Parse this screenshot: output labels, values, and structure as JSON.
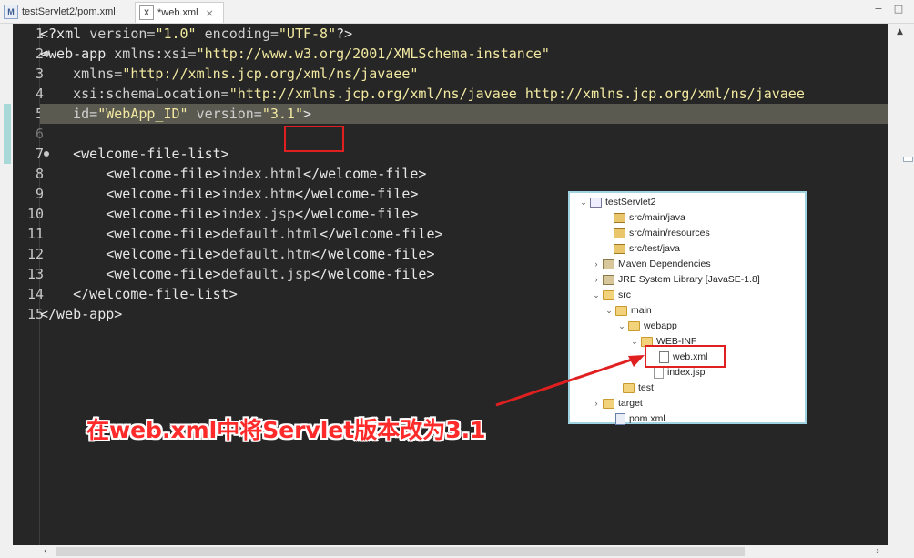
{
  "tabs": [
    {
      "label": "testServlet2/pom.xml",
      "icon": "pom-file-icon",
      "active": false
    },
    {
      "label": "*web.xml",
      "icon": "xml-file-icon",
      "active": true
    }
  ],
  "window_controls": {
    "minimize": "−",
    "maximize": "□"
  },
  "editor": {
    "line_numbers": [
      "1",
      "2",
      "3",
      "4",
      "5",
      "6",
      "7",
      "8",
      "9",
      "10",
      "11",
      "12",
      "13",
      "14",
      "15"
    ],
    "lines": [
      [
        {
          "t": "tag",
          "s": "<?xml "
        },
        {
          "t": "attr",
          "s": "version="
        },
        {
          "t": "str",
          "s": "\"1.0\""
        },
        {
          "t": "attr",
          "s": " encoding="
        },
        {
          "t": "str",
          "s": "\"UTF-8\""
        },
        {
          "t": "tag",
          "s": "?>"
        }
      ],
      [
        {
          "t": "tag",
          "s": "<web-app "
        },
        {
          "t": "attr",
          "s": "xmlns:xsi="
        },
        {
          "t": "str",
          "s": "\"http://www.w3.org/2001/XMLSchema-instance\""
        }
      ],
      [
        {
          "t": "attr",
          "s": "    xmlns="
        },
        {
          "t": "str",
          "s": "\"http://xmlns.jcp.org/xml/ns/javaee\""
        }
      ],
      [
        {
          "t": "attr",
          "s": "    xsi:schemaLocation="
        },
        {
          "t": "str",
          "s": "\"http://xmlns.jcp.org/xml/ns/javaee http://xmlns.jcp.org/xml/ns/javaee"
        }
      ],
      [
        {
          "t": "attr",
          "s": "    id="
        },
        {
          "t": "str",
          "s": "\"WebApp_ID\""
        },
        {
          "t": "attr",
          "s": " version="
        },
        {
          "t": "str",
          "s": "\"3.1\""
        },
        {
          "t": "tag",
          "s": ">"
        }
      ],
      [],
      [
        {
          "t": "tag",
          "s": "    <welcome-file-list>"
        }
      ],
      [
        {
          "t": "tag",
          "s": "        <welcome-file>"
        },
        {
          "t": "attr",
          "s": "index.html"
        },
        {
          "t": "tag",
          "s": "</welcome-file>"
        }
      ],
      [
        {
          "t": "tag",
          "s": "        <welcome-file>"
        },
        {
          "t": "attr",
          "s": "index.htm"
        },
        {
          "t": "tag",
          "s": "</welcome-file>"
        }
      ],
      [
        {
          "t": "tag",
          "s": "        <welcome-file>"
        },
        {
          "t": "attr",
          "s": "index.jsp"
        },
        {
          "t": "tag",
          "s": "</welcome-file>"
        }
      ],
      [
        {
          "t": "tag",
          "s": "        <welcome-file>"
        },
        {
          "t": "attr",
          "s": "default.html"
        },
        {
          "t": "tag",
          "s": "</welcome-file>"
        }
      ],
      [
        {
          "t": "tag",
          "s": "        <welcome-file>"
        },
        {
          "t": "attr",
          "s": "default.htm"
        },
        {
          "t": "tag",
          "s": "</welcome-file>"
        }
      ],
      [
        {
          "t": "tag",
          "s": "        <welcome-file>"
        },
        {
          "t": "attr",
          "s": "default.jsp"
        },
        {
          "t": "tag",
          "s": "</welcome-file>"
        }
      ],
      [
        {
          "t": "tag",
          "s": "    </welcome-file-list>"
        }
      ],
      [
        {
          "t": "tag",
          "s": "</web-app>"
        }
      ]
    ],
    "current_line": "5"
  },
  "project_tree": {
    "items": [
      {
        "label": "testServlet2",
        "icon": "project-icon",
        "chevron": "open"
      },
      {
        "label": "src/main/java",
        "icon": "source-folder-icon",
        "chevron": ""
      },
      {
        "label": "src/main/resources",
        "icon": "source-folder-icon",
        "chevron": ""
      },
      {
        "label": "src/test/java",
        "icon": "source-folder-icon",
        "chevron": ""
      },
      {
        "label": "Maven Dependencies",
        "icon": "library-icon",
        "chevron": "closed"
      },
      {
        "label": "JRE System Library [JavaSE-1.8]",
        "icon": "library-icon",
        "chevron": "closed"
      },
      {
        "label": "src",
        "icon": "folder-icon",
        "chevron": "open"
      },
      {
        "label": "main",
        "icon": "folder-icon",
        "chevron": "open"
      },
      {
        "label": "webapp",
        "icon": "folder-icon",
        "chevron": "open"
      },
      {
        "label": "WEB-INF",
        "icon": "folder-icon",
        "chevron": "open"
      },
      {
        "label": "web.xml",
        "icon": "xml-file-icon",
        "chevron": ""
      },
      {
        "label": "index.jsp",
        "icon": "jsp-file-icon",
        "chevron": ""
      },
      {
        "label": "test",
        "icon": "folder-icon",
        "chevron": ""
      },
      {
        "label": "target",
        "icon": "folder-icon",
        "chevron": "closed"
      },
      {
        "label": "pom.xml",
        "icon": "pom-file-icon",
        "chevron": ""
      }
    ]
  },
  "annotation": {
    "text": "在web.xml中将Servlet版本改为3.1",
    "color": "#ff2a2a"
  },
  "colors": {
    "editor_bg": "#262626",
    "highlight_bg": "#5a5a50",
    "string": "#f2e8a0",
    "annotation_red": "#e02020"
  }
}
